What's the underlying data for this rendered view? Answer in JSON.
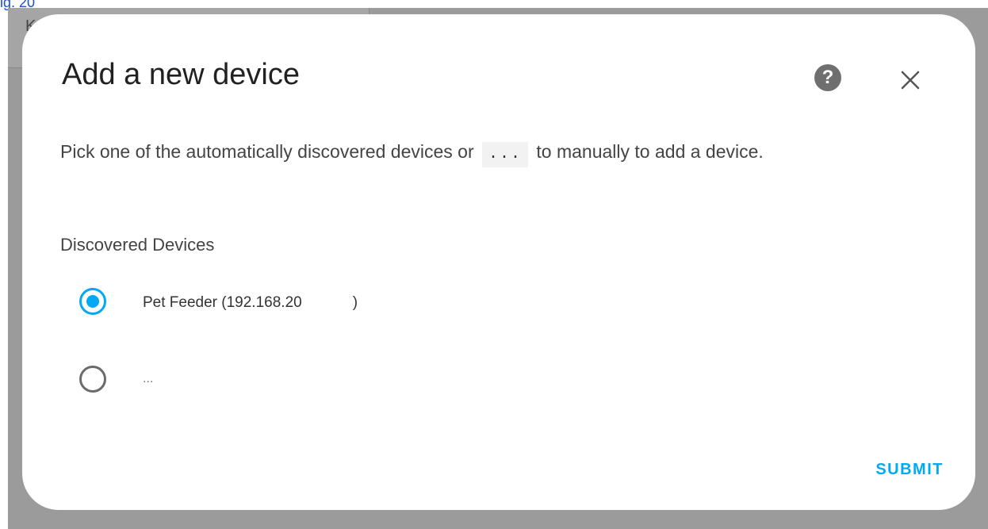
{
  "caption": "ig. 20",
  "background": {
    "letter": "K"
  },
  "dialog": {
    "title": "Add a new device",
    "help_icon": "help-circle-icon",
    "help_glyph": "?",
    "close_icon": "close-icon",
    "description_before": "Pick one of the automatically discovered devices or",
    "description_code": "...",
    "description_after": "to manually to add a device.",
    "section_label": "Discovered Devices",
    "options": [
      {
        "label_start": "Pet Feeder (192.168.20",
        "label_end": ")",
        "selected": true
      },
      {
        "label": "...",
        "selected": false
      }
    ],
    "submit_label": "SUBMIT"
  },
  "colors": {
    "accent": "#03a9f4",
    "overlay": "#9b9b9b",
    "caption": "#1a4fd6"
  }
}
